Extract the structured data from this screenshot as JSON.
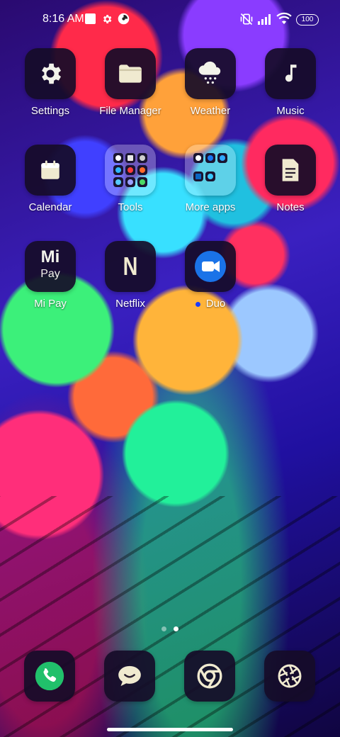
{
  "status_bar": {
    "time": "8:16 AM",
    "battery": "100"
  },
  "apps": {
    "settings": "Settings",
    "file_manager": "File Manager",
    "weather": "Weather",
    "music": "Music",
    "calendar": "Calendar",
    "tools": "Tools",
    "more_apps": "More apps",
    "notes": "Notes",
    "mi_pay": "Mi Pay",
    "netflix": "Netflix",
    "duo": "Duo"
  },
  "icon_text": {
    "mi_pay_top": "Mi",
    "mi_pay_bottom": "Pay",
    "netflix_letter": "N"
  },
  "page_indicator": {
    "pages": 2,
    "current": 2
  },
  "dock": [
    "phone-icon",
    "messages-icon",
    "chrome-icon",
    "camera-icon"
  ],
  "colors": {
    "duo_blue": "#1a73e8",
    "phone_green": "#21c06b",
    "notification_dot": "#1a3cff"
  }
}
